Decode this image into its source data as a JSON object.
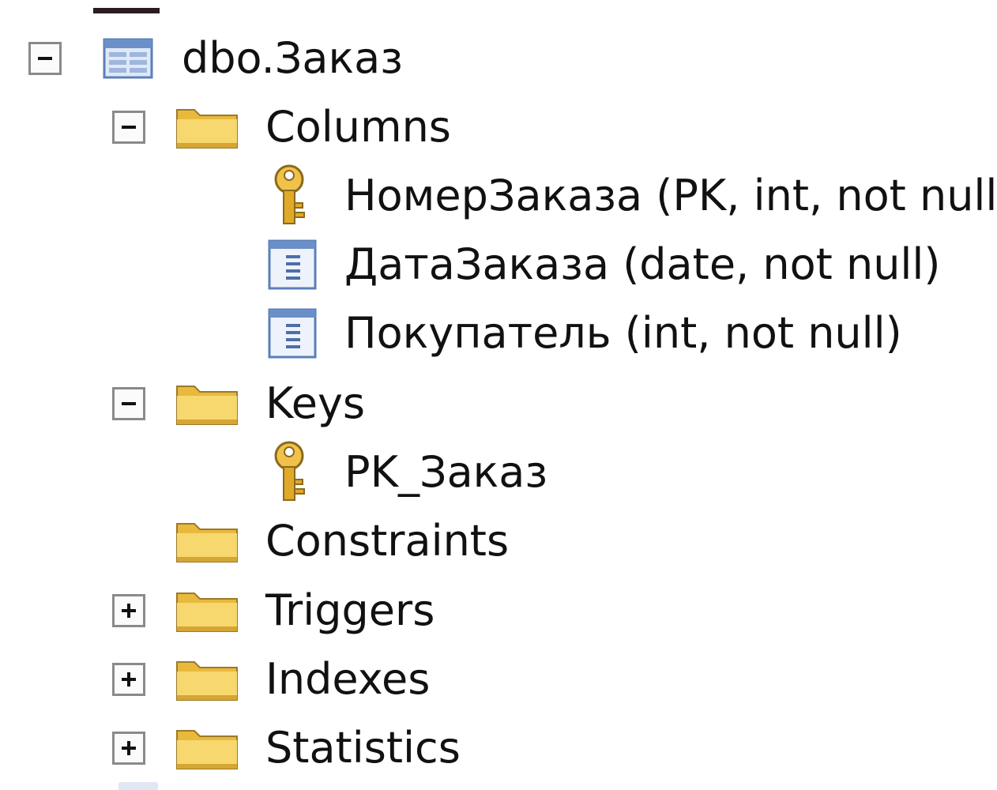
{
  "tree": {
    "table": {
      "label": "dbo.Заказ",
      "icon": "table-icon",
      "expanded": true
    },
    "columns_folder": {
      "label": "Columns",
      "icon": "folder-icon",
      "expanded": true,
      "items": [
        {
          "label": "НомерЗаказа (PK, int, not null)",
          "icon": "primary-key-icon"
        },
        {
          "label": "ДатаЗаказа (date, not null)",
          "icon": "column-icon"
        },
        {
          "label": "Покупатель (int, not null)",
          "icon": "column-icon"
        }
      ]
    },
    "keys_folder": {
      "label": "Keys",
      "icon": "folder-icon",
      "expanded": true,
      "items": [
        {
          "label": "PK_Заказ",
          "icon": "primary-key-icon"
        }
      ]
    },
    "constraints_folder": {
      "label": "Constraints",
      "icon": "folder-icon"
    },
    "triggers_folder": {
      "label": "Triggers",
      "icon": "folder-icon",
      "expanded": false
    },
    "indexes_folder": {
      "label": "Indexes",
      "icon": "folder-icon",
      "expanded": false
    },
    "statistics_folder": {
      "label": "Statistics",
      "icon": "folder-icon",
      "expanded": false
    }
  },
  "colors": {
    "folder": "#f3cf63",
    "key": "#e0a928",
    "table_header": "#6b8fc9",
    "toggle_border": "#8a8a8a"
  }
}
